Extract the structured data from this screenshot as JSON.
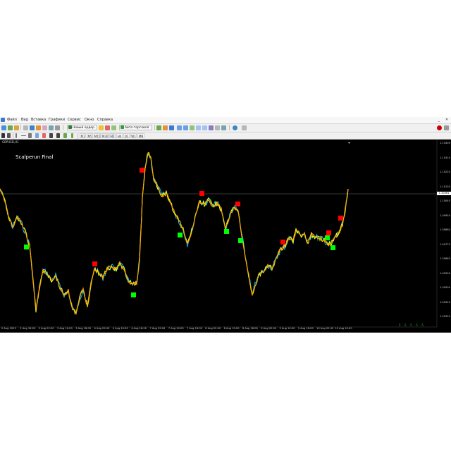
{
  "menubar": {
    "items": [
      "Файл",
      "Вид",
      "Вставка",
      "Графики",
      "Сервис",
      "Окно",
      "Справка"
    ],
    "window_buttons": [
      "_",
      "✕"
    ]
  },
  "toolbar": {
    "new_order_label": "Новый ордер",
    "autotrading_label": "Авто-торговля",
    "timeframes": [
      "M1",
      "M5",
      "M15",
      "M30",
      "H1",
      "H4",
      "D1",
      "W1",
      "MN"
    ]
  },
  "chart": {
    "symbol_label": "GBPUSD,H1",
    "indicator_label": "Scalperun Final",
    "status_text": "5 ·5 ·5 ·5 ·5",
    "current_price_tag": "1.10061",
    "y_ticks": [
      "1.10400",
      "1.10310",
      "1.10220",
      "1.10130",
      "1.10040",
      "1.09950",
      "1.09860",
      "1.09770",
      "1.09680",
      "1.09590",
      "1.09500",
      "1.09410",
      "1.09320"
    ],
    "x_ticks": [
      "2 Aug 2023",
      "2 Aug 18:00",
      "3 Aug 02:00",
      "3 Aug 10:00",
      "3 Aug 18:00",
      "4 Aug 02:00",
      "4 Aug 10:00",
      "4 Aug 18:00",
      "7 Aug 02:00",
      "7 Aug 10:00",
      "7 Aug 18:00",
      "8 Aug 02:00",
      "8 Aug 10:00",
      "8 Aug 18:00",
      "9 Aug 02:00",
      "9 Aug 10:00",
      "9 Aug 18:00",
      "10 Aug 02:00",
      "10 Aug 10:00"
    ],
    "colors": {
      "background": "#000000",
      "line_primary": "#ffa500",
      "line_secondary": "#ffff00",
      "line_tertiary": "#00bfff",
      "buy_signal": "#00ff00",
      "sell_signal": "#ff0000"
    },
    "sell_signals": 9,
    "buy_signals": 9
  }
}
